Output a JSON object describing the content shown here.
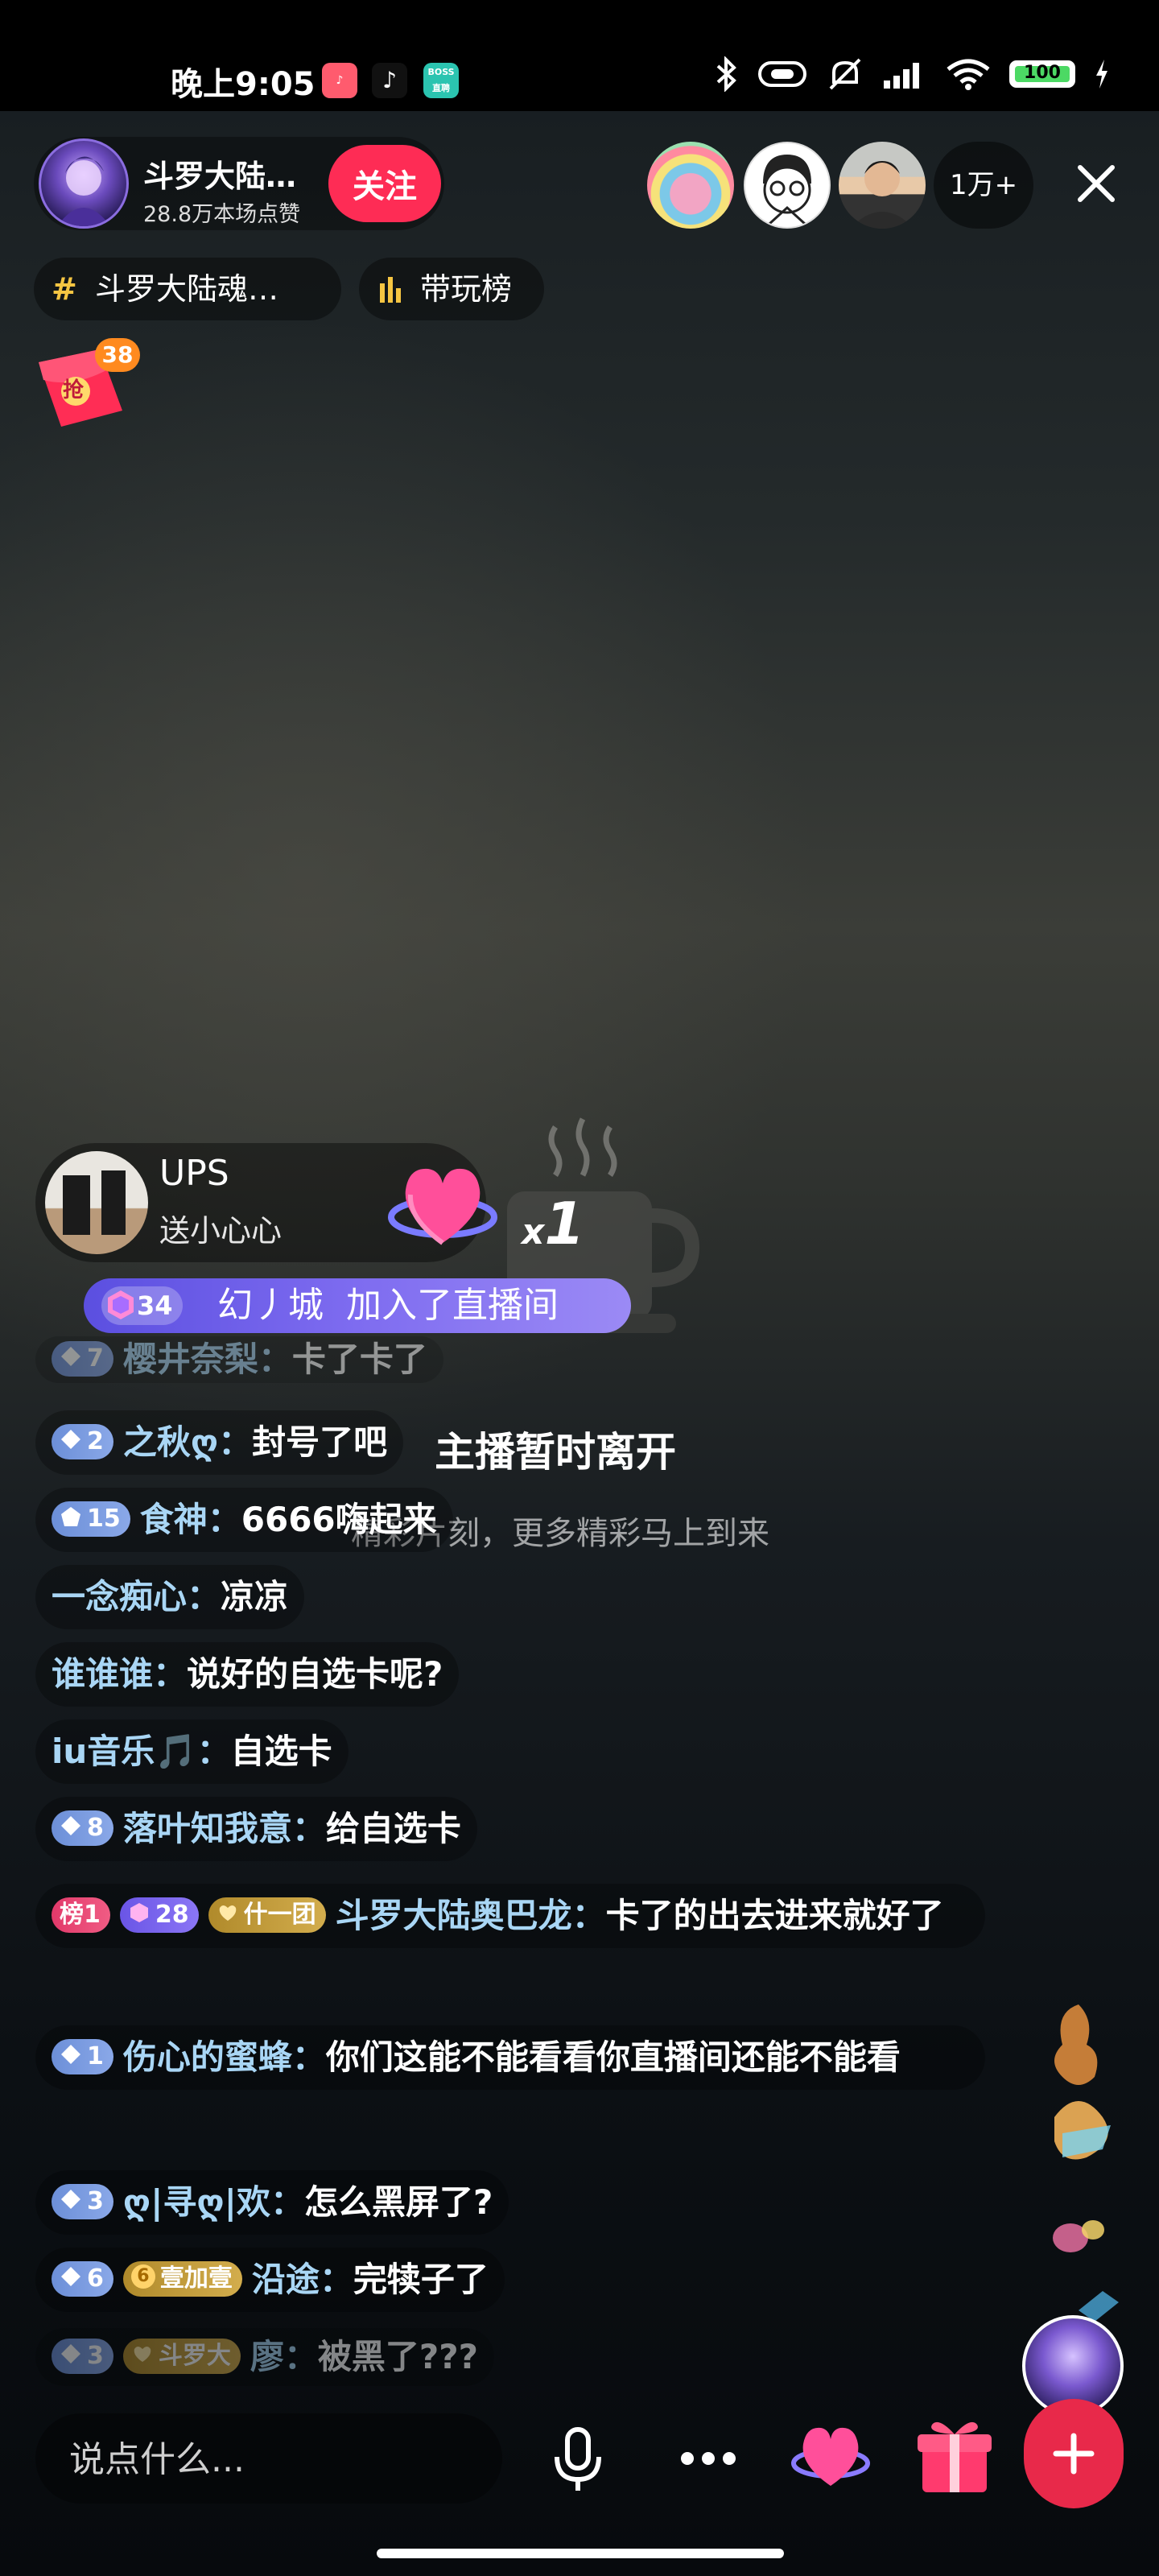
{
  "status_bar": {
    "time": "晚上9:05",
    "apps": [
      "music-app-icon",
      "tiktok-icon",
      "boss-zhipin-icon"
    ],
    "boss_label": "BOSS直聘",
    "battery": "100"
  },
  "header": {
    "host_name": "斗罗大陆…",
    "host_likes": "28.8万本场点赞",
    "follow_label": "关注",
    "viewer_count": "1万+"
  },
  "tags": {
    "topic": "斗罗大陆魂…",
    "ranking": "带玩榜"
  },
  "red_packet": {
    "count": "38",
    "char": "抢"
  },
  "overlay": {
    "title": "主播暂时离开",
    "subtitle": "精彩片刻，更多精彩马上到来"
  },
  "gift": {
    "user": "UPS",
    "action": "送小心心",
    "count": "1"
  },
  "join": {
    "level": "34",
    "user": "幻丿城",
    "text": "加入了直播间"
  },
  "chat": [
    {
      "level": "7",
      "user": "樱井奈梨：",
      "msg": "卡了卡了"
    },
    {
      "level": "2",
      "user": "之秋ღ：",
      "msg": "封号了吧"
    },
    {
      "level": "15",
      "user": "食神：",
      "msg": "6666嗨起来"
    },
    {
      "user": "一念痴心：",
      "msg": "凉凉"
    },
    {
      "user": "谁谁谁：",
      "msg": "说好的自选卡呢?"
    },
    {
      "user": "iu音乐🎵：",
      "msg": "自选卡"
    },
    {
      "level": "8",
      "user": "落叶知我意：",
      "msg": "给自选卡"
    },
    {
      "rank": "榜1",
      "level": "28",
      "fan": "什一团",
      "user": "斗罗大陆奥巴龙：",
      "msg": "卡了的出去进来就好了"
    },
    {
      "level": "1",
      "user": "伤心的蜜蜂：",
      "msg": "你们这能不能看看你直播间还能不能看"
    },
    {
      "level": "3",
      "user": "ღ|寻ღ|欢：",
      "msg": "怎么黑屏了?"
    },
    {
      "level": "6",
      "fan_level": "6",
      "fan": "壹加壹",
      "user": "沿途：",
      "msg": "完犊子了"
    },
    {
      "level": "3",
      "fan": "斗罗大",
      "user": "廖：",
      "msg": "被黑了???"
    }
  ],
  "bottom": {
    "comment_placeholder": "说点什么..."
  },
  "colors": {
    "accent": "#fe2c55",
    "username": "#a9d6f5",
    "join_banner": "#7e6cf0"
  }
}
